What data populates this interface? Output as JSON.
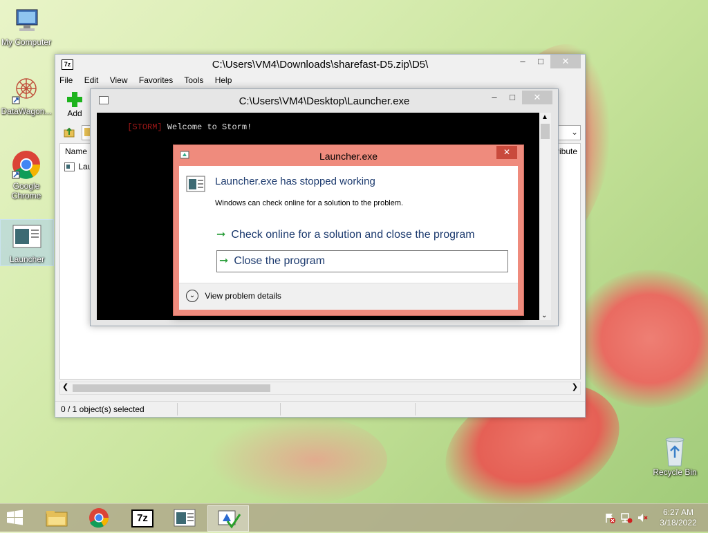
{
  "desktop": {
    "icons": [
      {
        "label": "My Computer"
      },
      {
        "label": "DataWagon..."
      },
      {
        "label": "Google Chrome"
      },
      {
        "label": "Launcher"
      },
      {
        "label": "Recycle Bin"
      }
    ]
  },
  "archive_window": {
    "title": "C:\\Users\\VM4\\Downloads\\sharefast-D5.zip\\D5\\",
    "app_icon": "7z",
    "menu": [
      "File",
      "Edit",
      "View",
      "Favorites",
      "Tools",
      "Help"
    ],
    "add_label": "Add",
    "columns": [
      "Name",
      "ribute"
    ],
    "rows": [
      {
        "name": "Lau"
      }
    ],
    "status": "0 / 1 object(s) selected"
  },
  "console_window": {
    "title": "C:\\Users\\VM4\\Desktop\\Launcher.exe",
    "prefix": "[STORM]",
    "message": " Welcome to Storm!"
  },
  "error_dialog": {
    "title": "Launcher.exe",
    "heading": "Launcher.exe has stopped working",
    "subtext": "Windows can check online for a solution to the problem.",
    "option_check": "Check online for a solution and close the program",
    "option_close": "Close the program",
    "details": "View problem details"
  },
  "taskbar": {
    "clock_time": "6:27 AM",
    "clock_date": "3/18/2022"
  },
  "colors": {
    "dialog_frame": "#ef8b7d",
    "heading_blue": "#1c3a6e",
    "arrow_green": "#2a9e3a"
  }
}
